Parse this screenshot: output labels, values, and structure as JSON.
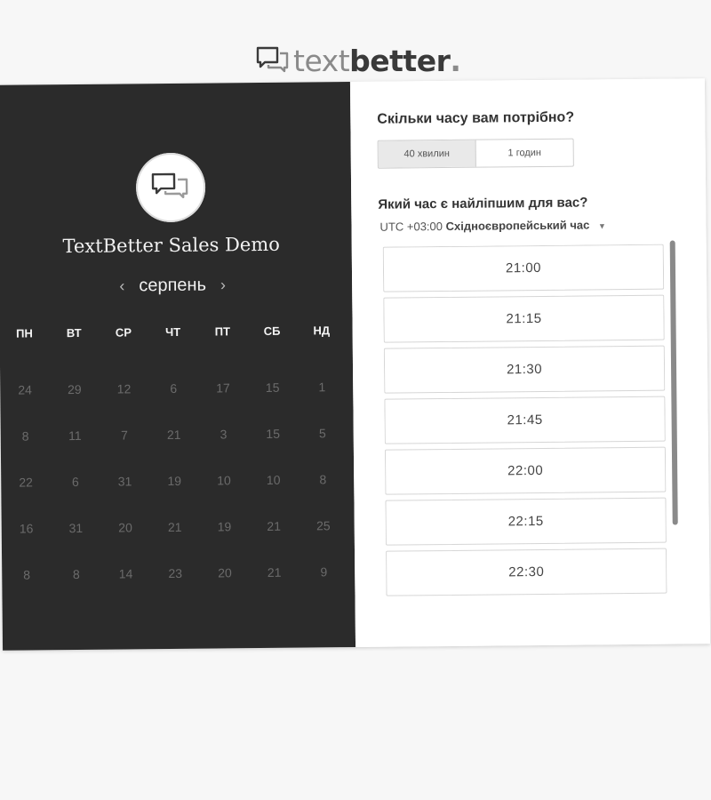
{
  "logo": {
    "word1": "text",
    "word2": "better",
    "dot": "."
  },
  "left_panel": {
    "avatar_icon": "chat-bubbles-icon",
    "event_title": "TextBetter Sales Demo",
    "month": "серпень",
    "prev_icon": "‹",
    "next_icon": "›",
    "weekdays": [
      "ПН",
      "ВТ",
      "СР",
      "ЧТ",
      "ПТ",
      "СБ",
      "НД"
    ],
    "days": [
      [
        "24",
        "29",
        "12",
        "6",
        "17",
        "15",
        "1"
      ],
      [
        "8",
        "11",
        "7",
        "21",
        "3",
        "15",
        "5"
      ],
      [
        "22",
        "6",
        "31",
        "19",
        "10",
        "10",
        "8"
      ],
      [
        "16",
        "31",
        "20",
        "21",
        "19",
        "21",
        "25"
      ],
      [
        "8",
        "8",
        "14",
        "23",
        "20",
        "21",
        "9"
      ]
    ]
  },
  "right_panel": {
    "duration_question": "Скільки часу вам потрібно?",
    "duration_options": [
      "40 хвилин",
      "1 годин"
    ],
    "selected_duration": "40 хвилин",
    "time_question": "Який час є найліпшим для вас?",
    "timezone_offset": "UTC +03:00",
    "timezone_name": "Східноєвропейський час",
    "time_slots": [
      "21:00",
      "21:15",
      "21:30",
      "21:45",
      "22:00",
      "22:15",
      "22:30",
      ""
    ]
  },
  "colors": {
    "dark_panel": "#2b2b2b",
    "background": "#f7f7f7",
    "text_dark": "#333333"
  }
}
